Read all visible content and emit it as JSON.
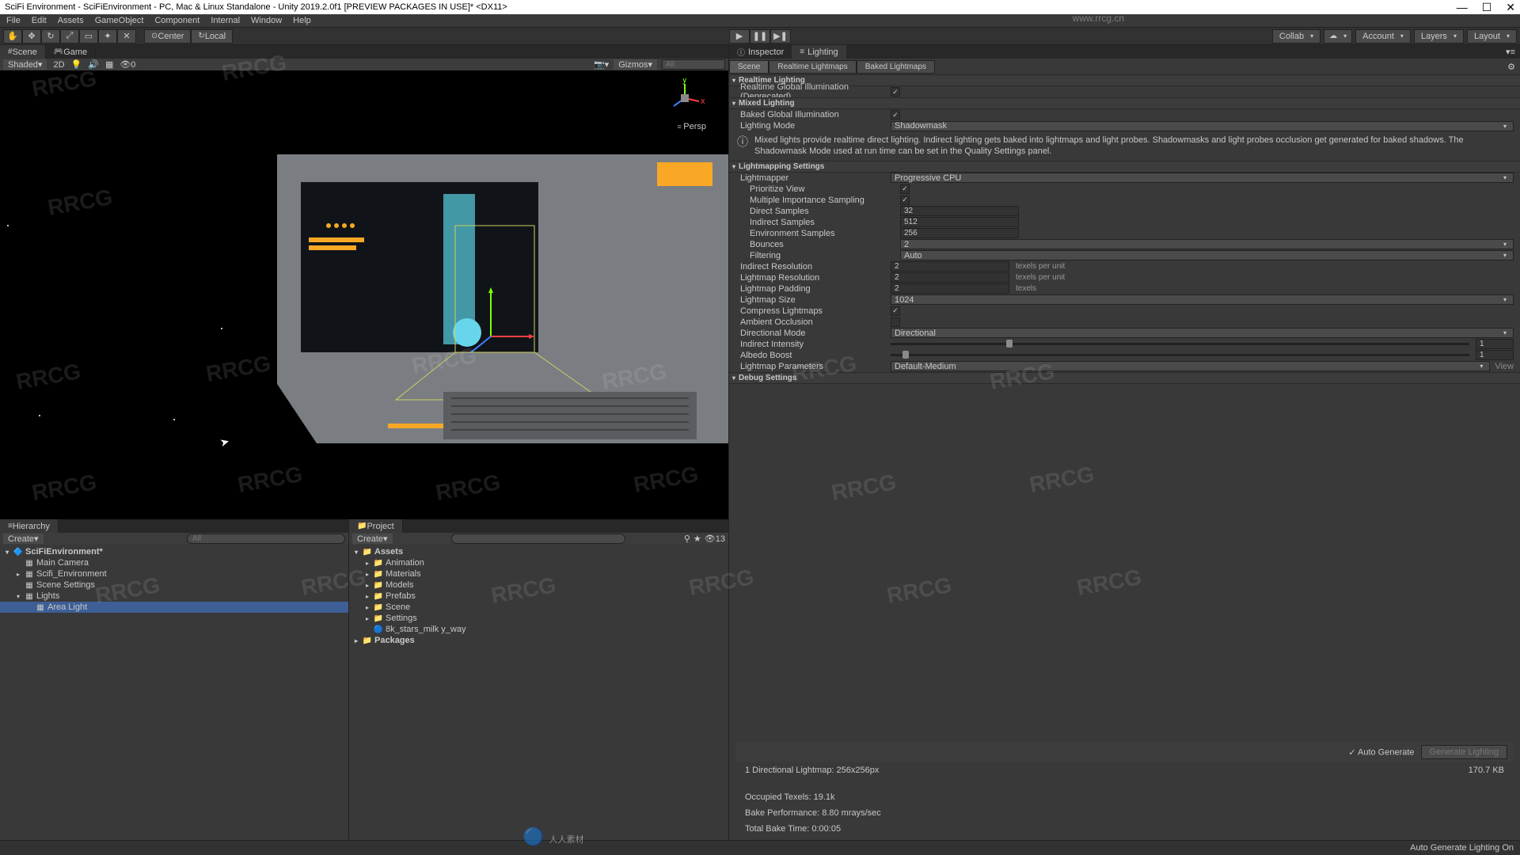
{
  "window": {
    "title": "SciFi Environment - SciFiEnvironment - PC, Mac & Linux Standalone - Unity 2019.2.0f1 [PREVIEW PACKAGES IN USE]* <DX11>",
    "watermark_url": "www.rrcg.cn"
  },
  "menus": [
    "File",
    "Edit",
    "Assets",
    "GameObject",
    "Component",
    "Internal",
    "Window",
    "Help"
  ],
  "toolbar": {
    "pivot_center": "Center",
    "pivot_local": "Local",
    "right": {
      "collab": "Collab",
      "account": "Account",
      "layers": "Layers",
      "layout": "Layout"
    }
  },
  "scene_tabs": {
    "scene": "Scene",
    "game": "Game"
  },
  "scene_bar": {
    "shading": "Shaded",
    "mode2d": "2D",
    "gizmos": "Gizmos",
    "search": "All",
    "persp": "Persp"
  },
  "hierarchy": {
    "title": "Hierarchy",
    "create": "Create",
    "search": "All",
    "root": "SciFiEnvironment*",
    "items": [
      "Main Camera",
      "Scifi_Environment",
      "Scene Settings",
      "Lights"
    ],
    "selected": "Area Light"
  },
  "project": {
    "title": "Project",
    "create": "Create",
    "stats": "13",
    "assets": "Assets",
    "folders": [
      "Animation",
      "Materials",
      "Models",
      "Prefabs",
      "Scene",
      "Settings"
    ],
    "asset_file": "8k_stars_milk y_way",
    "packages": "Packages"
  },
  "inspector": {
    "inspector_tab": "Inspector",
    "lighting_tab": "Lighting",
    "subtabs": [
      "Scene",
      "Realtime Lightmaps",
      "Baked Lightmaps"
    ],
    "sections": {
      "realtime": {
        "title": "Realtime Lighting",
        "global_illum": "Realtime Global Illumination (Deprecated)"
      },
      "mixed": {
        "title": "Mixed Lighting",
        "baked_gi": "Baked Global Illumination",
        "lighting_mode": "Lighting Mode",
        "lighting_mode_val": "Shadowmask",
        "info": "Mixed lights provide realtime direct lighting. Indirect lighting gets baked into lightmaps and light probes. Shadowmasks and light probes occlusion get generated for baked shadows. The Shadowmask Mode used at run time can be set in the Quality Settings panel."
      },
      "lightmapping": {
        "title": "Lightmapping Settings",
        "rows": [
          {
            "label": "Lightmapper",
            "type": "dd",
            "val": "Progressive CPU"
          },
          {
            "label": "Prioritize View",
            "type": "chk",
            "val": "✓",
            "indent": 1
          },
          {
            "label": "Multiple Importance Sampling",
            "type": "chk",
            "val": "✓",
            "indent": 1
          },
          {
            "label": "Direct Samples",
            "type": "num",
            "val": "32",
            "indent": 1
          },
          {
            "label": "Indirect Samples",
            "type": "num",
            "val": "512",
            "indent": 1
          },
          {
            "label": "Environment Samples",
            "type": "num",
            "val": "256",
            "indent": 1
          },
          {
            "label": "Bounces",
            "type": "dd",
            "val": "2",
            "indent": 1
          },
          {
            "label": "Filtering",
            "type": "dd",
            "val": "Auto",
            "indent": 1
          },
          {
            "label": "Indirect Resolution",
            "type": "num",
            "val": "2",
            "unit": "texels per unit"
          },
          {
            "label": "Lightmap Resolution",
            "type": "num",
            "val": "2",
            "unit": "texels per unit"
          },
          {
            "label": "Lightmap Padding",
            "type": "num",
            "val": "2",
            "unit": "texels"
          },
          {
            "label": "Lightmap Size",
            "type": "dd",
            "val": "1024"
          },
          {
            "label": "Compress Lightmaps",
            "type": "chk",
            "val": "✓"
          },
          {
            "label": "Ambient Occlusion",
            "type": "chk",
            "val": ""
          },
          {
            "label": "Directional Mode",
            "type": "dd",
            "val": "Directional"
          },
          {
            "label": "Indirect Intensity",
            "type": "slider",
            "val": "1",
            "pos": 20
          },
          {
            "label": "Albedo Boost",
            "type": "slider",
            "val": "1",
            "pos": 2
          },
          {
            "label": "Lightmap Parameters",
            "type": "dd",
            "val": "Default-Medium",
            "btn": "View"
          }
        ]
      },
      "debug": {
        "title": "Debug Settings"
      }
    },
    "footer": {
      "auto_generate": "Auto Generate",
      "generate_btn": "Generate Lighting",
      "lightmap_info": "1 Directional Lightmap: 256x256px",
      "lightmap_size": "170.7 KB",
      "occupied": "Occupied Texels: 19.1k",
      "bake_perf": "Bake Performance: 8.80 mrays/sec",
      "bake_time": "Total Bake Time: 0:00:05"
    }
  },
  "statusbar": {
    "text": "Auto Generate Lighting On"
  },
  "watermark_text": "RRCG",
  "watermark_cn": "人人素材"
}
